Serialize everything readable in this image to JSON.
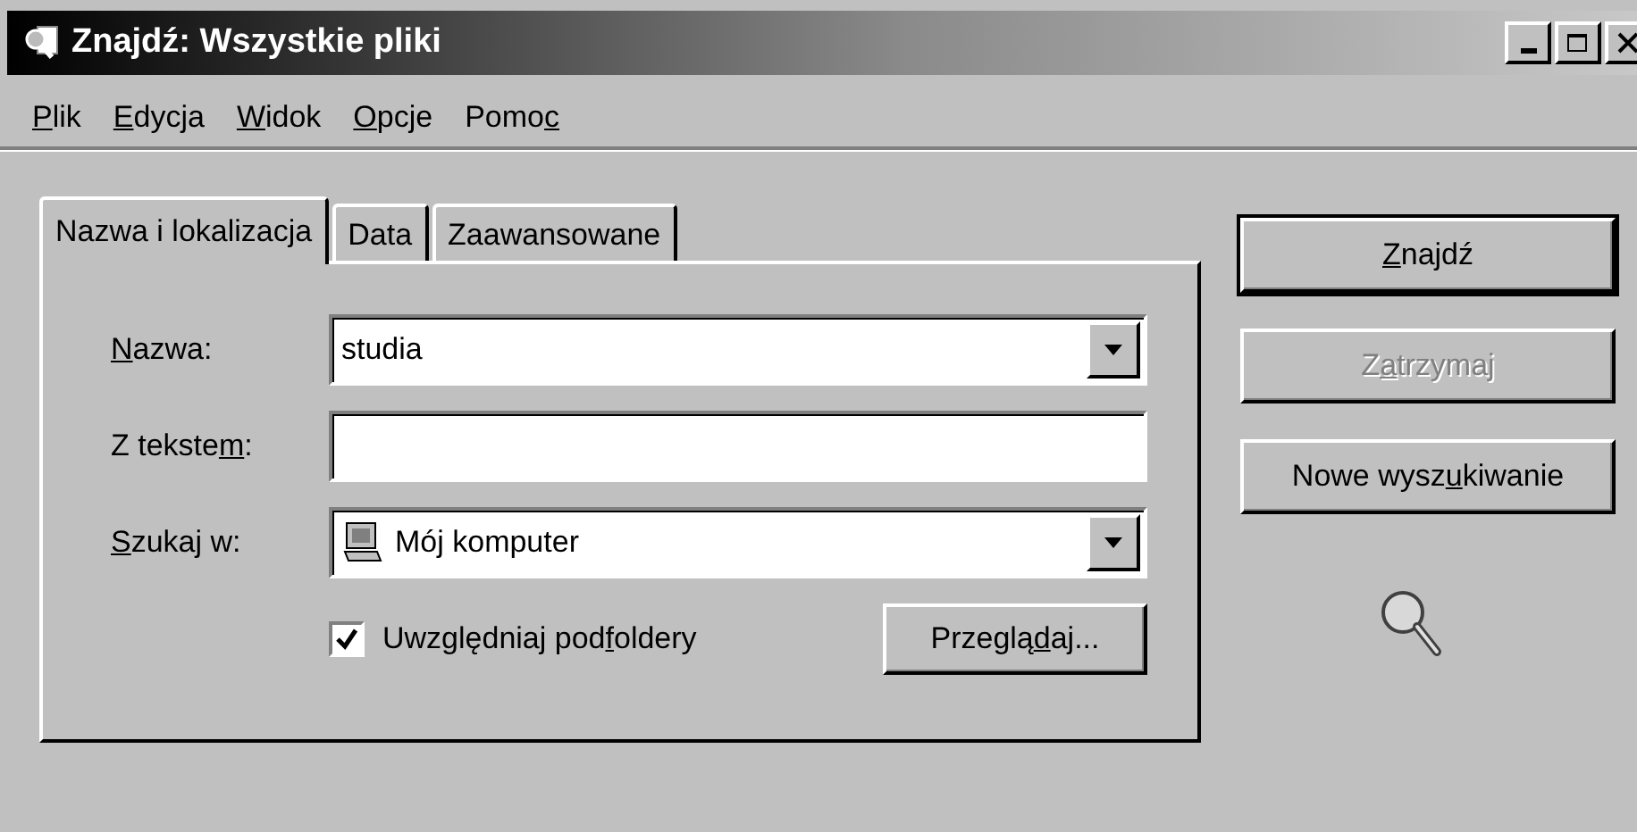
{
  "window": {
    "title": "Znajdź: Wszystkie pliki",
    "controls": [
      {
        "kind": "minimize"
      },
      {
        "kind": "maximize"
      },
      {
        "kind": "close"
      }
    ]
  },
  "menu": [
    {
      "label": [
        {
          "text": "P",
          "underline": true
        },
        {
          "text": "lik",
          "underline": false
        }
      ]
    },
    {
      "label": [
        {
          "text": "E",
          "underline": true
        },
        {
          "text": "dycja",
          "underline": false
        }
      ]
    },
    {
      "label": [
        {
          "text": "W",
          "underline": true
        },
        {
          "text": "idok",
          "underline": false
        }
      ]
    },
    {
      "label": [
        {
          "text": "O",
          "underline": true
        },
        {
          "text": "pcje",
          "underline": false
        }
      ]
    },
    {
      "label": [
        {
          "text": "Pomo",
          "underline": false
        },
        {
          "text": "c",
          "underline": true
        }
      ]
    }
  ],
  "tabs": [
    {
      "label": "Nazwa i lokalizacja",
      "selected": true
    },
    {
      "label": "Data",
      "selected": false
    },
    {
      "label": "Zaawansowane",
      "selected": false
    }
  ],
  "fields": [
    {
      "kind": "combo",
      "label": [
        {
          "text": "N",
          "underline": true
        },
        {
          "text": "azwa:",
          "underline": false
        }
      ],
      "value": "studia"
    },
    {
      "kind": "text",
      "label": [
        {
          "text": "Z tekste",
          "underline": false
        },
        {
          "text": "m",
          "underline": true
        },
        {
          "text": ":",
          "underline": false
        }
      ]
    },
    {
      "kind": "combo-icon",
      "label": [
        {
          "text": "S",
          "underline": true
        },
        {
          "text": "zukaj w:",
          "underline": false
        }
      ],
      "value": "Mój komputer"
    }
  ],
  "subfolders": {
    "label": [
      {
        "text": "Uwzględniaj pod",
        "underline": false
      },
      {
        "text": "f",
        "underline": true
      },
      {
        "text": "oldery",
        "underline": false
      }
    ],
    "checked": true
  },
  "browse_button": {
    "label": [
      {
        "text": "Przeglą",
        "underline": false
      },
      {
        "text": "d",
        "underline": true
      },
      {
        "text": "aj...",
        "underline": false
      }
    ]
  },
  "buttons": [
    {
      "label": [
        {
          "text": "Z",
          "underline": true
        },
        {
          "text": "najdź",
          "underline": false
        }
      ],
      "disabled": false,
      "default": true
    },
    {
      "label": [
        {
          "text": "Z",
          "underline": false
        },
        {
          "text": "a",
          "underline": true
        },
        {
          "text": "trzymaj",
          "underline": false
        }
      ],
      "disabled": true,
      "default": false
    },
    {
      "label": [
        {
          "text": "Nowe wysz",
          "underline": false
        },
        {
          "text": "u",
          "underline": true
        },
        {
          "text": "kiwanie",
          "underline": false
        }
      ],
      "disabled": false,
      "default": false
    }
  ]
}
